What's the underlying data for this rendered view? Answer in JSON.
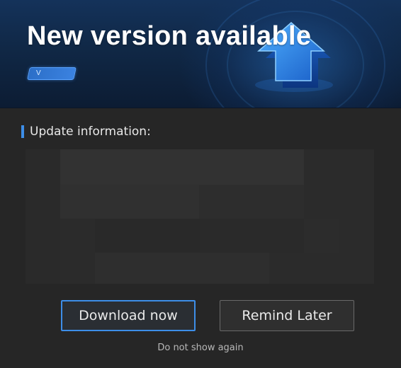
{
  "dialog": {
    "title": "New version available",
    "version_label": "V",
    "section_label": "Update information:",
    "buttons": {
      "download": "Download now",
      "remind": "Remind Later"
    },
    "dont_show": "Do not show again"
  },
  "colors": {
    "accent": "#3d8ee8",
    "banner": "#102846",
    "background": "#262626"
  }
}
